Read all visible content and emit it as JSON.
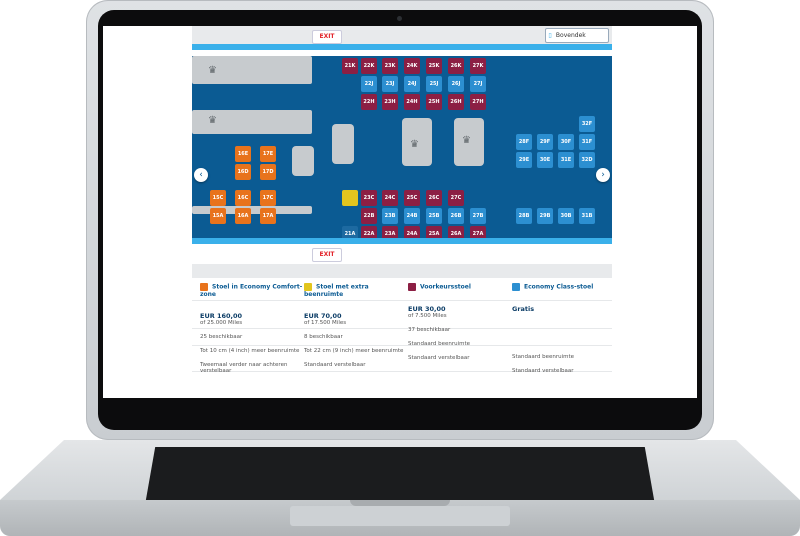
{
  "seatmap": {
    "exit_label": "EXIT",
    "deck_toggle_label": "Bovendek",
    "rows_top": [
      "21K",
      "22K",
      "23K",
      "24K",
      "25K",
      "26K",
      "27K"
    ],
    "rows_top2": [
      "21J",
      "22J",
      "23J",
      "24J",
      "25J",
      "26J",
      "27J"
    ],
    "rows_top3": [
      "21H",
      "22H",
      "23H",
      "24H",
      "25H",
      "26H",
      "27H"
    ],
    "rows_mid_left": [
      "16E",
      "17E"
    ],
    "rows_mid_left2": [
      "16D",
      "17D"
    ],
    "rows_bot_left": [
      "15C",
      "16C",
      "17C"
    ],
    "rows_bot_left2": [
      "15A",
      "16A",
      "17A"
    ],
    "rows_bot_right": [
      "23C",
      "24C",
      "25C",
      "26C",
      "27C"
    ],
    "rows_bot_right2": [
      "22B",
      "23B",
      "24B",
      "25B",
      "26B",
      "27B"
    ],
    "rows_bot_right3": [
      "21A",
      "22A",
      "23A",
      "24A",
      "25A",
      "26A",
      "27A"
    ],
    "rows_right_top": [
      "28F",
      "29F",
      "30F",
      "31F",
      "32F"
    ],
    "rows_right_mid": [
      "29E",
      "30E",
      "31E",
      "32D"
    ],
    "rows_right_bot": [
      "28B",
      "29B",
      "30B",
      "31B"
    ]
  },
  "legend": {
    "columns": [
      {
        "title": "Stoel in Economy Comfort-zone",
        "price": "EUR 160,00",
        "miles": "of 25.000 Miles",
        "available": "25 beschikbaar",
        "legroom": "Tot 10 cm (4 inch) meer beenruimte",
        "recline": "Tweemaal verder naar achteren verstelbaar",
        "color": "#e8731c"
      },
      {
        "title": "Stoel met extra beenruimte",
        "price": "EUR 70,00",
        "miles": "of 17.500 Miles",
        "available": "8 beschikbaar",
        "legroom": "Tot 22 cm (9 inch) meer beenruimte",
        "recline": "Standaard verstelbaar",
        "color": "#e2c51e"
      },
      {
        "title": "Voorkeursstoel",
        "price": "EUR 30,00",
        "miles": "of 7.500 Miles",
        "available": "37 beschikbaar",
        "legroom": "Standaard beenruimte",
        "recline": "Standaard verstelbaar",
        "color": "#8c1f44"
      },
      {
        "title": "Economy Class-stoel",
        "price": "Gratis",
        "miles": "",
        "available": "",
        "legroom": "Standaard beenruimte",
        "recline": "Standaard verstelbaar",
        "color": "#2c8fd1"
      }
    ]
  }
}
